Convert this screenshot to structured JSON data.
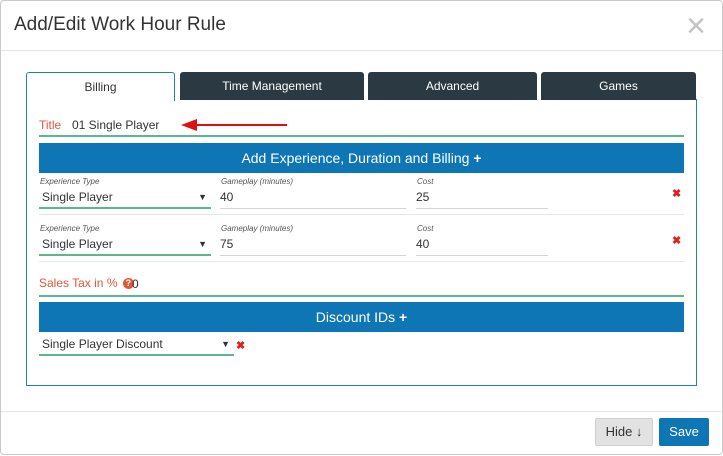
{
  "modal": {
    "title": "Add/Edit Work Hour Rule",
    "close_icon": "×"
  },
  "tabs": [
    {
      "label": "Billing",
      "active": true
    },
    {
      "label": "Time Management",
      "active": false
    },
    {
      "label": "Advanced",
      "active": false
    },
    {
      "label": "Games",
      "active": false
    }
  ],
  "billing": {
    "title_label": "Title",
    "title_value": "01 Single Player",
    "add_experience_label": "Add Experience, Duration and Billing",
    "plus_icon": "+",
    "rows": [
      {
        "experience_type_label": "Experience Type",
        "experience_type_value": "Single Player",
        "gameplay_label": "Gameplay (minutes)",
        "gameplay_value": "40",
        "cost_label": "Cost",
        "cost_value": "25"
      },
      {
        "experience_type_label": "Experience Type",
        "experience_type_value": "Single Player",
        "gameplay_label": "Gameplay (minutes)",
        "gameplay_value": "75",
        "cost_label": "Cost",
        "cost_value": "40"
      }
    ],
    "delete_icon": "✖",
    "sales_tax_label": "Sales Tax in %",
    "help_icon": "?",
    "sales_tax_value": "0",
    "discount_ids_label": "Discount IDs",
    "discount_value": "Single Player Discount"
  },
  "footer": {
    "hide_label": "Hide ↓",
    "save_label": "Save"
  },
  "colors": {
    "primary_blue": "#0f76b5",
    "tab_dark": "#2b3a42",
    "accent_green": "#5cb88c",
    "label_red": "#e2563a",
    "delete_red": "#e02020",
    "arrow_red": "#e01010"
  }
}
